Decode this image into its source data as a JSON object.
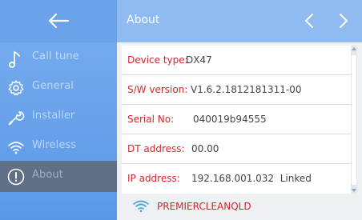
{
  "header": {
    "title": "About"
  },
  "sidebar": {
    "items": [
      {
        "label": "Call tune",
        "icon": "music-note-icon"
      },
      {
        "label": "General",
        "icon": "gear-icon"
      },
      {
        "label": "Installer",
        "icon": "wrench-icon"
      },
      {
        "label": "Wireless",
        "icon": "wifi-icon"
      },
      {
        "label": "About",
        "icon": "info-icon",
        "active": true
      }
    ]
  },
  "about": {
    "rows": [
      {
        "key": "Device type:",
        "value": "DX47"
      },
      {
        "key": "S/W version:",
        "value": "V1.6.2.1812181311-00"
      },
      {
        "key": "Serial No:",
        "value": "040019b94555"
      },
      {
        "key": "DT address:",
        "value": "00.00"
      },
      {
        "key": "IP address:",
        "value": "192.168.001.032  Linked"
      }
    ]
  },
  "wifi": {
    "ssid": "PREMIERCLEANQLD"
  },
  "colors": {
    "accent_red": "#d6262b",
    "sidebar_blue": "#6aa3ea",
    "header_blue": "#8fbaf2",
    "active_item": "#5f6f86"
  }
}
